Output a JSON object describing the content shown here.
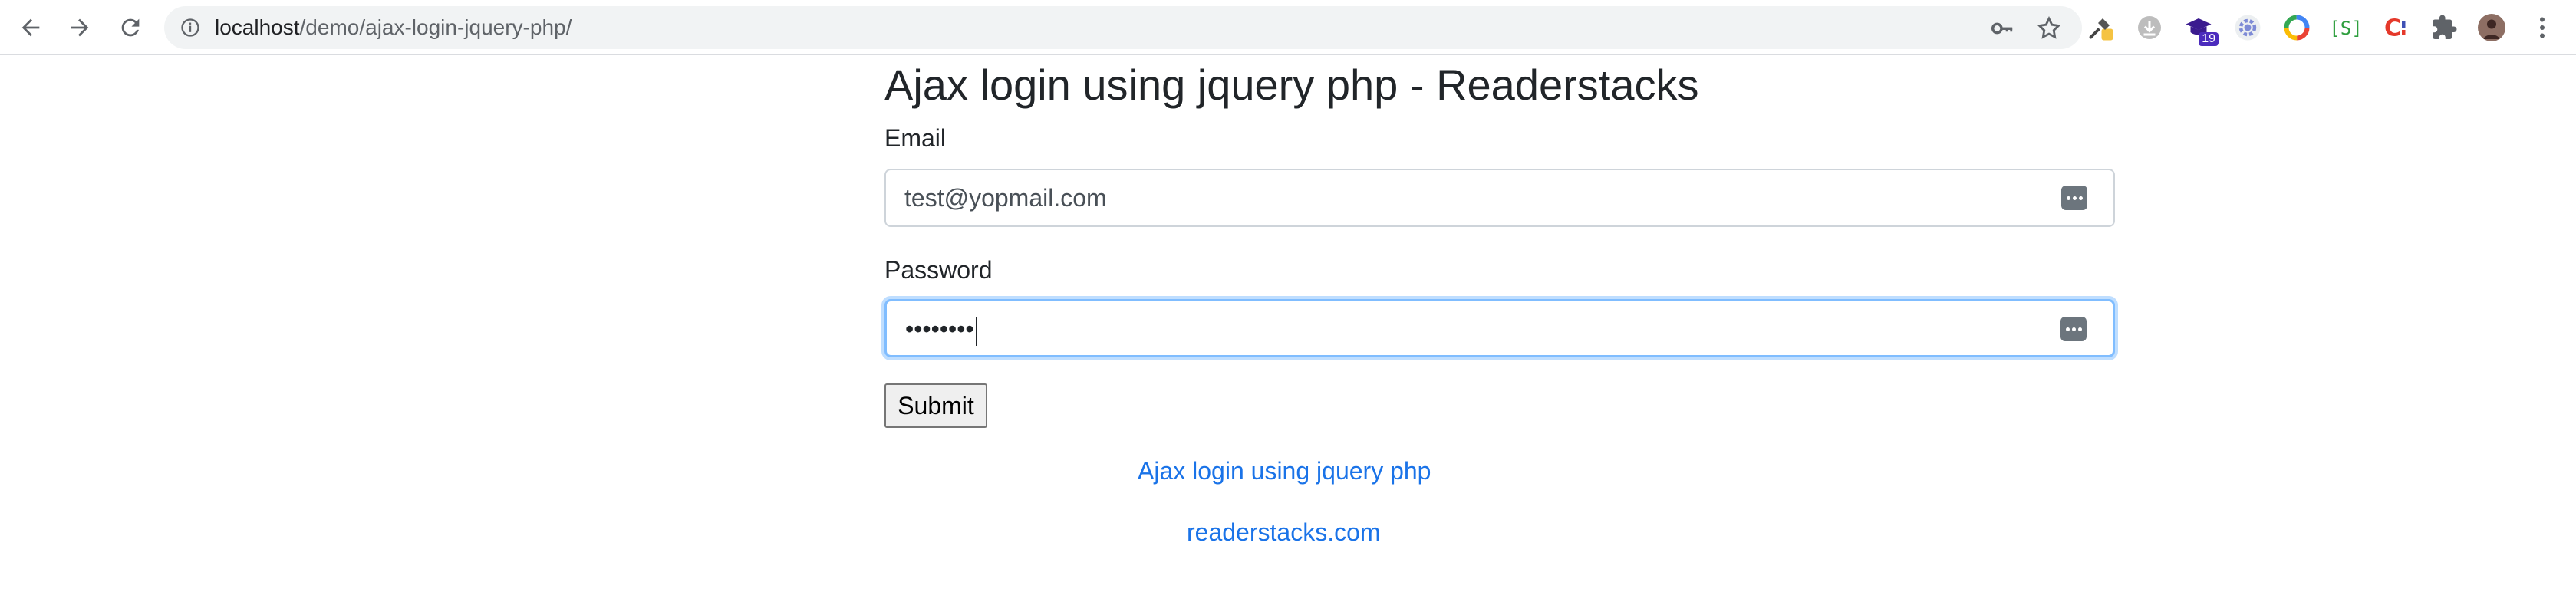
{
  "browser": {
    "url_host": "localhost",
    "url_path": "/demo/ajax-login-jquery-php/",
    "extension_badge": "19",
    "accent_color": "#1a73e8"
  },
  "page": {
    "title": "Ajax login using jquery php - Readerstacks",
    "email_label": "Email",
    "email_value": "test@yopmail.com",
    "password_label": "Password",
    "password_value": "••••••••",
    "submit_label": "Submit",
    "link_1": "Ajax login using jquery php",
    "link_2": "readerstacks.com"
  },
  "icons": {
    "back": "arrow-left-icon",
    "forward": "arrow-right-icon",
    "reload": "reload-icon",
    "site_info": "info-icon",
    "password_key": "key-icon",
    "bookmark": "star-icon",
    "extensions": "puzzle-icon",
    "menu": "kebab-menu-icon"
  }
}
